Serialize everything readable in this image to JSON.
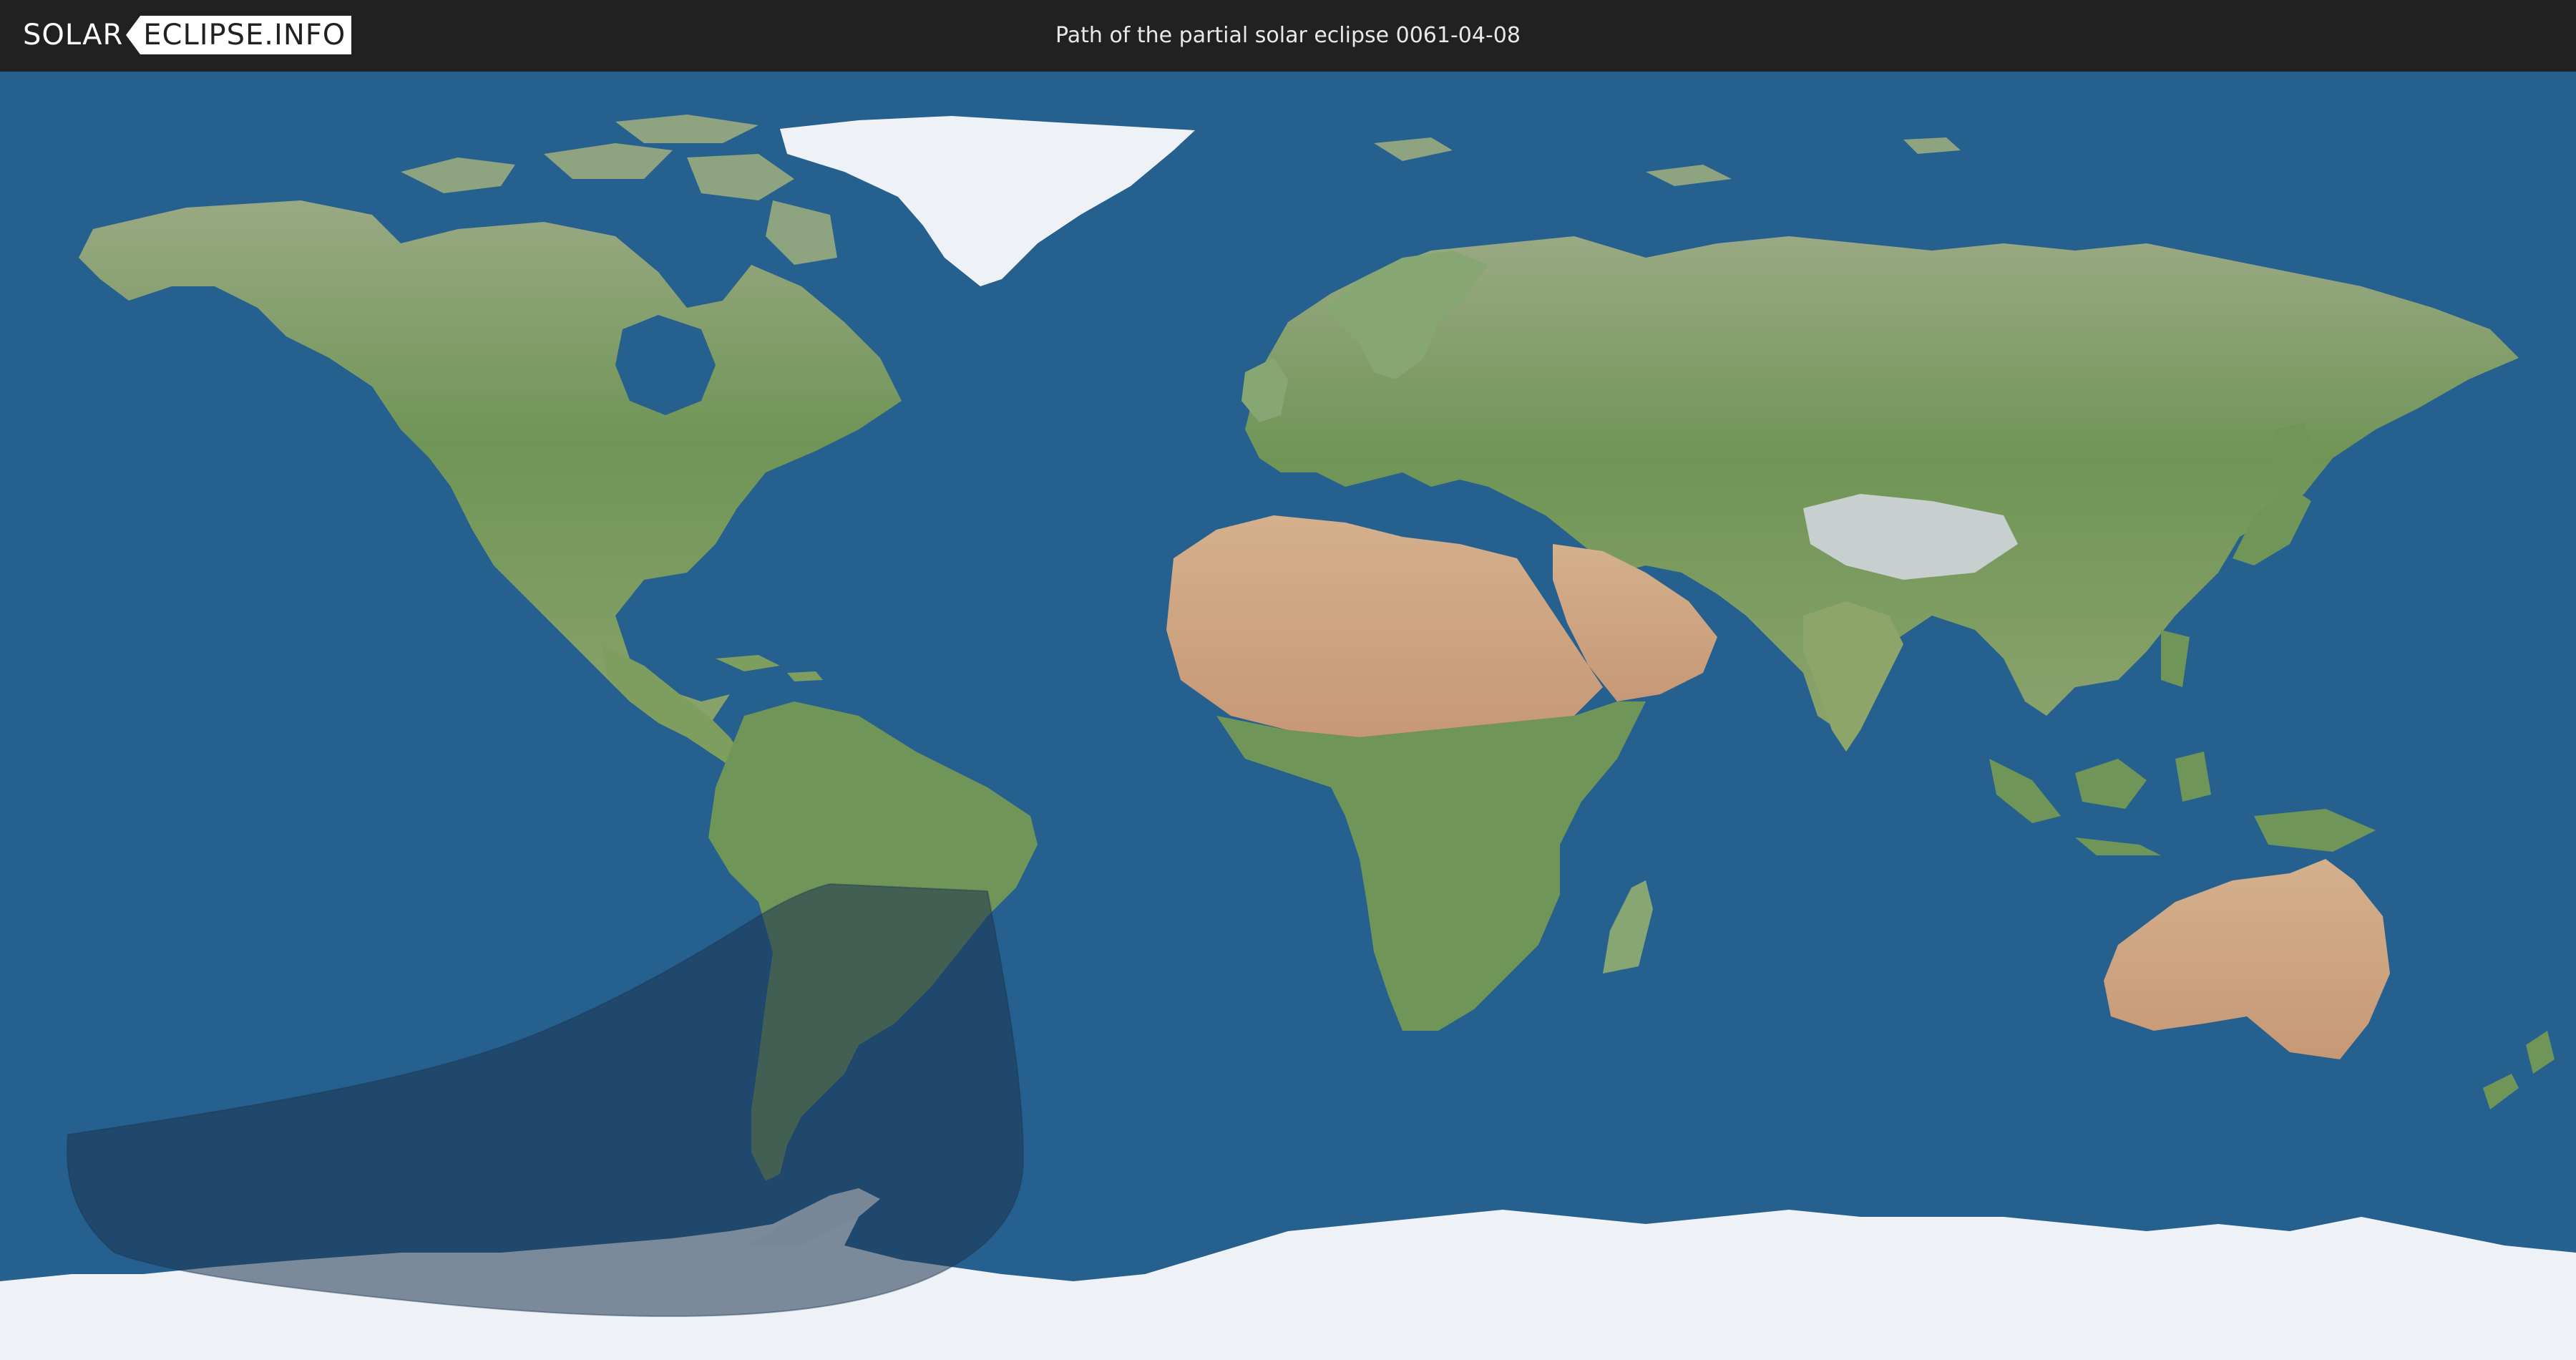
{
  "header": {
    "logo_left": "SOLAR",
    "logo_right": "ECLIPSE.INFO",
    "title": "Path of the partial solar eclipse 0061-04-08"
  },
  "map": {
    "projection": "equirectangular",
    "shaded_region": "partial eclipse visibility",
    "colors": {
      "ocean": "#26608e",
      "land": "#7d9a5e",
      "desert": "#c9a27a",
      "ice": "#eef2f6",
      "eclipse_shade": "#1b3550",
      "header_bg": "#212121"
    }
  }
}
